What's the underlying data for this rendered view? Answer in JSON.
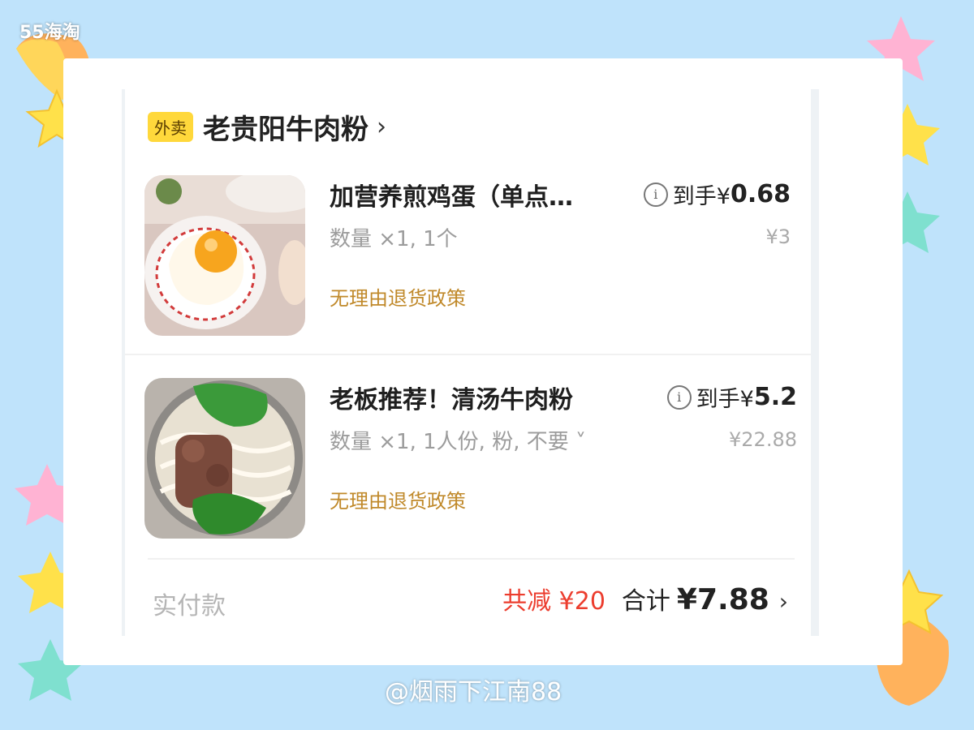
{
  "watermark": {
    "top": "55海淘",
    "bottom": "@烟雨下江南88"
  },
  "store": {
    "tag": "外卖",
    "name": "老贵阳牛肉粉",
    "chevron": "›"
  },
  "items": [
    {
      "title": "加营养煎鸡蛋（单点…",
      "spec": "数量 ×1, 1个",
      "policy": "无理由退货政策",
      "final_label": "到手¥",
      "final_amount": "0.68",
      "original_price": "¥3",
      "image": "fried-egg-photo"
    },
    {
      "title": "老板推荐！清汤牛肉粉",
      "spec": "数量 ×1, 1人份, 粉, 不要 ˅",
      "policy": "无理由退货政策",
      "final_label": "到手¥",
      "final_amount": "5.2",
      "original_price": "¥22.88",
      "image": "beef-noodle-photo"
    }
  ],
  "footer": {
    "label": "实付款",
    "discount": "共减 ¥20",
    "total_label": "合计",
    "total_amount": "¥7.88",
    "chevron": "›"
  },
  "icons": {
    "info": "info-icon",
    "chevron": "chevron-right-icon"
  },
  "colors": {
    "tag_bg": "#ffd83b",
    "discount": "#ec3d2e",
    "policy": "#c0892a",
    "background": "#bfe3fb"
  }
}
